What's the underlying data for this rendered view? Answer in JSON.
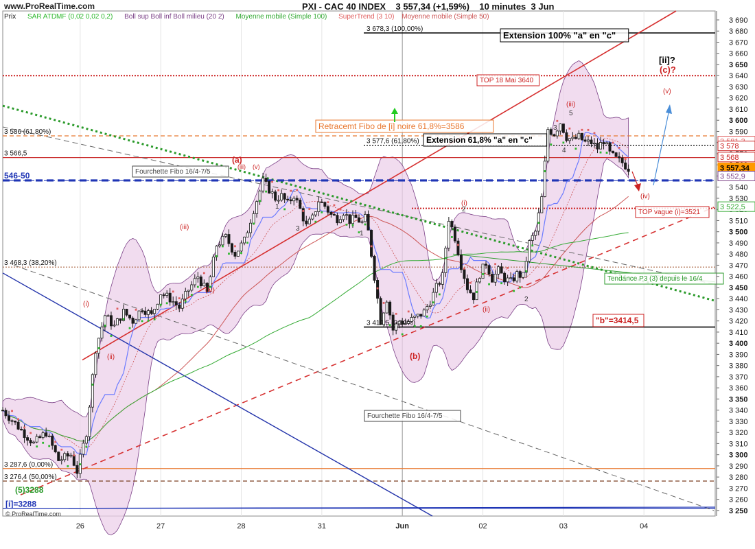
{
  "header": {
    "site": "www.ProRealTime.com",
    "title": "PXI - CAC 40 INDEX",
    "last_price": "3 557,34",
    "change": "(+1,59%)",
    "interval": "10 minutes",
    "date": "3 Jun"
  },
  "indicators": {
    "price_label": "Prix",
    "sar": "SAR ATDMF (0,02 0,02 0,2)",
    "bollinger": "Boll sup Boll inf Boll milieu (20 2)",
    "ma100": "Moyenne mobile (Simple 100)",
    "supertrend": "SuperTrend (3 10)",
    "ma50": "Moyenne mobile (Simple 50)"
  },
  "copyright": "© ProRealTime.com",
  "colors": {
    "candle": "#1a1a1a",
    "bollinger_fill": "#ecd0ea",
    "bollinger_line": "#7a3f86",
    "sar": "#2db82d",
    "supertrend": "#e06060",
    "ma100": "#33aa33",
    "ma50": "#cc5555",
    "channel_red": "#d63030",
    "channel_blue": "#2233aa",
    "pitchfork": "#666666",
    "trend_green": "#2a9a2a",
    "support_blue": "#1f35b5",
    "resistance_red": "#d83030",
    "fibo_orange": "#e8772e",
    "kijun_blue": "#6b7bff"
  },
  "chart_data": {
    "type": "candlestick",
    "x_ticks": [
      "26",
      "27",
      "28",
      "31",
      "Jun",
      "02",
      "03",
      "04"
    ],
    "ylim": [
      3245,
      3698
    ],
    "y_ticks": [
      3250,
      3260,
      3270,
      3280,
      3290,
      3300,
      3310,
      3320,
      3330,
      3340,
      3350,
      3360,
      3370,
      3380,
      3390,
      3400,
      3410,
      3420,
      3430,
      3440,
      3450,
      3460,
      3470,
      3480,
      3490,
      3500,
      3510,
      3520,
      3530,
      3540,
      3550,
      3560,
      3570,
      3580,
      3590,
      3600,
      3610,
      3620,
      3630,
      3640,
      3650,
      3660,
      3670,
      3680,
      3690
    ],
    "y_tick_labels": [
      "3 250",
      "3 260",
      "3 270",
      "3 280",
      "3 290",
      "3 300",
      "3 310",
      "3 320",
      "3 330",
      "3 340",
      "3 350",
      "3 360",
      "3 370",
      "3 380",
      "3 390",
      "3 400",
      "3 410",
      "3 420",
      "3 430",
      "3 440",
      "3 450",
      "3 460",
      "3 470",
      "3 480",
      "3 490",
      "3 500",
      "3 510",
      "3 520",
      "3 530",
      "3 540",
      "3 550",
      "3 560",
      "3 570",
      "3 580",
      "3 590",
      "3 600",
      "3 610",
      "3 620",
      "3 630",
      "3 640",
      "3 650",
      "3 660",
      "3 670",
      "3 680",
      "3 690"
    ],
    "bold_y_ticks": [
      3250,
      3300,
      3350,
      3400,
      3450,
      3500,
      3550,
      3600,
      3650
    ],
    "price_path": [
      [
        0,
        3340
      ],
      [
        5,
        3325
      ],
      [
        10,
        3310
      ],
      [
        14,
        3320
      ],
      [
        18,
        3295
      ],
      [
        22,
        3300
      ],
      [
        24,
        3285
      ],
      [
        27,
        3320
      ],
      [
        30,
        3395
      ],
      [
        33,
        3425
      ],
      [
        36,
        3415
      ],
      [
        39,
        3428
      ],
      [
        42,
        3420
      ],
      [
        45,
        3432
      ],
      [
        48,
        3425
      ],
      [
        51,
        3445
      ],
      [
        54,
        3440
      ],
      [
        57,
        3432
      ],
      [
        60,
        3448
      ],
      [
        63,
        3460
      ],
      [
        66,
        3445
      ],
      [
        69,
        3488
      ],
      [
        72,
        3495
      ],
      [
        75,
        3480
      ],
      [
        78,
        3492
      ],
      [
        81,
        3520
      ],
      [
        84,
        3545
      ],
      [
        86,
        3538
      ],
      [
        88,
        3530
      ],
      [
        90,
        3532
      ],
      [
        92,
        3525
      ],
      [
        94,
        3533
      ],
      [
        96,
        3520
      ],
      [
        98,
        3505
      ],
      [
        100,
        3512
      ],
      [
        102,
        3528
      ],
      [
        104,
        3523
      ],
      [
        106,
        3515
      ],
      [
        108,
        3512
      ],
      [
        110,
        3518
      ],
      [
        112,
        3510
      ],
      [
        114,
        3512
      ],
      [
        116,
        3508
      ],
      [
        117,
        3512
      ],
      [
        118,
        3500
      ],
      [
        120,
        3460
      ],
      [
        122,
        3420
      ],
      [
        124,
        3440
      ],
      [
        126,
        3412
      ],
      [
        128,
        3420
      ],
      [
        130,
        3418
      ],
      [
        132,
        3421
      ],
      [
        134,
        3424
      ],
      [
        136,
        3428
      ],
      [
        138,
        3438
      ],
      [
        140,
        3450
      ],
      [
        142,
        3460
      ],
      [
        144,
        3512
      ],
      [
        146,
        3495
      ],
      [
        148,
        3470
      ],
      [
        150,
        3450
      ],
      [
        152,
        3442
      ],
      [
        154,
        3462
      ],
      [
        156,
        3472
      ],
      [
        158,
        3458
      ],
      [
        160,
        3465
      ],
      [
        162,
        3458
      ],
      [
        164,
        3455
      ],
      [
        166,
        3462
      ],
      [
        168,
        3460
      ],
      [
        170,
        3490
      ],
      [
        172,
        3500
      ],
      [
        174,
        3530
      ],
      [
        176,
        3592
      ],
      [
        178,
        3588
      ],
      [
        180,
        3598
      ],
      [
        182,
        3585
      ],
      [
        184,
        3582
      ],
      [
        186,
        3585
      ],
      [
        188,
        3580
      ],
      [
        190,
        3580
      ],
      [
        192,
        3575
      ],
      [
        194,
        3582
      ],
      [
        196,
        3570
      ],
      [
        198,
        3565
      ],
      [
        200,
        3562
      ],
      [
        202,
        3557
      ]
    ],
    "support_resistance": [
      {
        "label": "3 678,3 (100,00%)",
        "value": 3678.3,
        "color": "#000000",
        "style": "solid"
      },
      {
        "label": "TOP 18 Mai 3640",
        "value": 3640,
        "color": "#cc2222",
        "style": "dotted"
      },
      {
        "label": "3 586 (61,80%)",
        "value": 3586,
        "color": "#e8772e",
        "style": "dashed"
      },
      {
        "label": "3 577,6 (61,80%)",
        "value": 3577.6,
        "color": "#000000",
        "style": "dotted"
      },
      {
        "label": "3 566,5",
        "value": 3566.5,
        "color": "#cc3333",
        "style": "solid"
      },
      {
        "label": "546-50",
        "value": 3546,
        "color": "#1f35b5",
        "style": "dashed"
      },
      {
        "label": "TOP vague (i)=3521",
        "value": 3521,
        "color": "#cc2222",
        "style": "dotted"
      },
      {
        "label": "3 468,3 (38,20%)",
        "value": 3468.3,
        "color": "#aa6644",
        "style": "dotted"
      },
      {
        "label": "3 414,5 (0,00%)",
        "value": 3414.5,
        "color": "#000000",
        "style": "solid"
      },
      {
        "label": "3 287,6 (0,00%)",
        "value": 3287.6,
        "color": "#e8772e",
        "style": "solid"
      },
      {
        "label": "3 276,4 (50,00%)",
        "value": 3276.4,
        "color": "#7a3f20",
        "style": "dashed"
      },
      {
        "label": "[i]=3288",
        "value": 3252,
        "color": "#1f35b5",
        "style": "solid"
      }
    ],
    "price_tags": [
      {
        "label": "3 581,3",
        "value": 3581.3,
        "color": "#e06060"
      },
      {
        "label": "3 578",
        "value": 3577,
        "color": "#cc2222"
      },
      {
        "label": "3 568",
        "value": 3567,
        "color": "#cc2222"
      },
      {
        "label": "3 557,34",
        "value": 3557.34,
        "color": "#ff9900"
      },
      {
        "label": "3 552,9",
        "value": 3550,
        "color": "#7a3f86"
      },
      {
        "label": "3 522,5",
        "value": 3522.5,
        "color": "#33aa33"
      }
    ],
    "annotations": [
      {
        "text": "Extension 100% \"a\" en \"c\"",
        "box": true,
        "color": "#000000"
      },
      {
        "text": "Retracemt Fibo de [i] noire 61,8%=3586",
        "box": true,
        "color": "#e8772e"
      },
      {
        "text": "Extension 61,8% \"a\" en \"c\"",
        "box": true,
        "color": "#000000"
      },
      {
        "text": "Fourchette Fibo 16/4-7/5",
        "box": true,
        "color": "#444444"
      },
      {
        "text": "Fourchette Fibo 16/4-7/5",
        "box": true,
        "color": "#444444"
      },
      {
        "text": "TOP 18 Mai 3640",
        "box": true,
        "color": "#cc2222"
      },
      {
        "text": "TOP vague (i)=3521",
        "box": true,
        "color": "#cc2222"
      },
      {
        "text": "\"b\"=3414,5",
        "box": true,
        "color": "#cc2222"
      },
      {
        "text": "Tendance P3 (3) depuis le 16/4",
        "box": true,
        "color": "#2a9a2a"
      },
      {
        "text": "[ii]?",
        "box": false,
        "color": "#000000"
      },
      {
        "text": "(c)?",
        "box": false,
        "color": "#cc2222"
      },
      {
        "text": "(v)",
        "box": false,
        "color": "#cc2222"
      },
      {
        "text": "(iv)",
        "box": false,
        "color": "#cc2222"
      },
      {
        "text": "(iii)",
        "box": false,
        "color": "#cc2222"
      },
      {
        "text": "(a)",
        "box": false,
        "color": "#cc2222"
      },
      {
        "text": "(b)",
        "box": false,
        "color": "#cc2222"
      },
      {
        "text": "(i)",
        "box": false,
        "color": "#cc2222"
      },
      {
        "text": "(ii)",
        "box": false,
        "color": "#cc2222"
      },
      {
        "text": "(iii)",
        "box": false,
        "color": "#cc2222"
      },
      {
        "text": "(iv)",
        "box": false,
        "color": "#cc2222"
      },
      {
        "text": "(i)",
        "box": false,
        "color": "#cc2222"
      },
      {
        "text": "(ii)",
        "box": false,
        "color": "#cc2222"
      },
      {
        "text": "(iii)",
        "box": false,
        "color": "#cc2222"
      },
      {
        "text": "(v)",
        "box": false,
        "color": "#cc2222"
      },
      {
        "text": "(5)3288",
        "box": false,
        "color": "#2a9a2a"
      },
      {
        "text": "5",
        "box": false,
        "color": "#333333"
      },
      {
        "text": "3",
        "box": false,
        "color": "#333333"
      },
      {
        "text": "4",
        "box": false,
        "color": "#333333"
      },
      {
        "text": "1",
        "box": false,
        "color": "#333333"
      },
      {
        "text": "2",
        "box": false,
        "color": "#333333"
      },
      {
        "text": "3",
        "box": false,
        "color": "#333333"
      },
      {
        "text": "1",
        "box": false,
        "color": "#333333"
      },
      {
        "text": "2",
        "box": false,
        "color": "#333333"
      }
    ]
  }
}
